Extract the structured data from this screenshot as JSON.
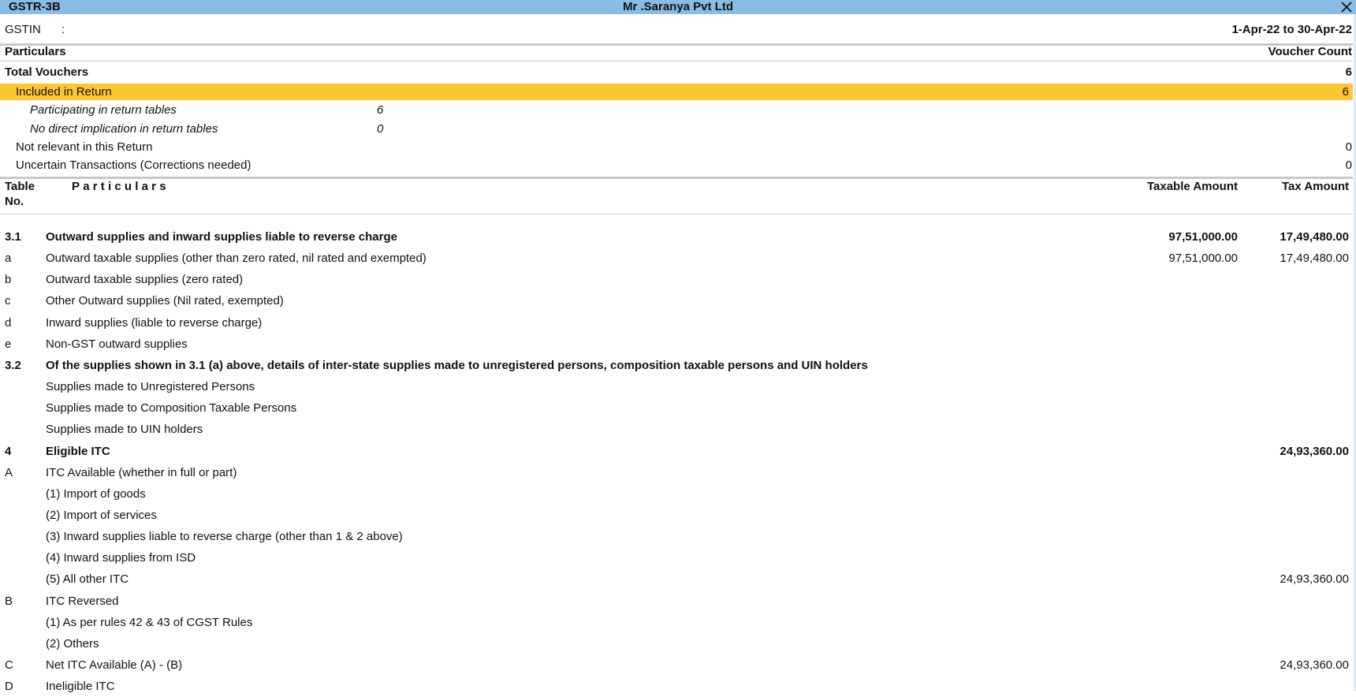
{
  "window": {
    "report_name": "GSTR-3B",
    "company_name": "Mr .Saranya Pvt Ltd",
    "close_icon": "close-icon"
  },
  "header": {
    "gstin_label": "GSTIN",
    "gstin_sep": ":",
    "gstin_value": "",
    "period": "1-Apr-22 to 30-Apr-22"
  },
  "summary": {
    "col_particulars": "Particulars",
    "col_count": "Voucher Count",
    "rows": [
      {
        "label": "Total Vouchers",
        "value": "6"
      },
      {
        "label": "Included in Return",
        "value": "6"
      },
      {
        "label": "Participating in return tables",
        "mid_value": "6"
      },
      {
        "label": "No direct implication in return tables",
        "mid_value": "0"
      },
      {
        "label": "Not relevant in this Return",
        "value": "0"
      },
      {
        "label": "Uncertain Transactions (Corrections needed)",
        "value": "0"
      }
    ]
  },
  "table": {
    "headers": {
      "table_no_line1": "Table",
      "table_no_line2": "No.",
      "particulars": "Particulars",
      "taxable_amount": "Taxable Amount",
      "tax_amount": "Tax Amount"
    },
    "rows": [
      {
        "no": "3.1",
        "particulars": "Outward supplies and inward supplies liable to reverse charge",
        "taxable": "97,51,000.00",
        "tax": "17,49,480.00",
        "bold": true
      },
      {
        "no": "a",
        "particulars": "Outward taxable supplies (other than zero rated, nil rated and exempted)",
        "taxable": "97,51,000.00",
        "tax": "17,49,480.00"
      },
      {
        "no": "b",
        "particulars": "Outward taxable supplies (zero rated)",
        "taxable": "",
        "tax": ""
      },
      {
        "no": "c",
        "particulars": "Other Outward supplies (Nil rated, exempted)",
        "taxable": "",
        "tax": ""
      },
      {
        "no": "d",
        "particulars": "Inward supplies (liable to reverse charge)",
        "taxable": "",
        "tax": ""
      },
      {
        "no": "e",
        "particulars": "Non-GST outward supplies",
        "taxable": "",
        "tax": ""
      },
      {
        "no": "3.2",
        "particulars": "Of the supplies shown in 3.1 (a) above, details of inter-state supplies made to unregistered persons, composition taxable persons and UIN holders",
        "taxable": "",
        "tax": "",
        "bold": true
      },
      {
        "no": "",
        "particulars": "Supplies made to Unregistered Persons",
        "taxable": "",
        "tax": ""
      },
      {
        "no": "",
        "particulars": "Supplies made to Composition Taxable Persons",
        "taxable": "",
        "tax": ""
      },
      {
        "no": "",
        "particulars": "Supplies made to UIN holders",
        "taxable": "",
        "tax": ""
      },
      {
        "no": "4",
        "particulars": "Eligible ITC",
        "taxable": "",
        "tax": "24,93,360.00",
        "bold": true
      },
      {
        "no": "A",
        "particulars": "ITC Available (whether in full or part)",
        "taxable": "",
        "tax": ""
      },
      {
        "no": "",
        "particulars": "(1) Import of goods",
        "taxable": "",
        "tax": ""
      },
      {
        "no": "",
        "particulars": "(2) Import of services",
        "taxable": "",
        "tax": ""
      },
      {
        "no": "",
        "particulars": "(3) Inward supplies liable to reverse charge (other than 1 & 2 above)",
        "taxable": "",
        "tax": ""
      },
      {
        "no": "",
        "particulars": "(4) Inward supplies from ISD",
        "taxable": "",
        "tax": ""
      },
      {
        "no": "",
        "particulars": "(5) All other ITC",
        "taxable": "",
        "tax": "24,93,360.00"
      },
      {
        "no": "B",
        "particulars": "ITC Reversed",
        "taxable": "",
        "tax": ""
      },
      {
        "no": "",
        "particulars": "(1) As per rules 42 & 43 of CGST Rules",
        "taxable": "",
        "tax": ""
      },
      {
        "no": "",
        "particulars": "(2) Others",
        "taxable": "",
        "tax": ""
      },
      {
        "no": "C",
        "particulars": "Net ITC Available (A) - (B)",
        "taxable": "",
        "tax": "24,93,360.00"
      },
      {
        "no": "D",
        "particulars": "Ineligible ITC",
        "taxable": "",
        "tax": ""
      }
    ]
  }
}
